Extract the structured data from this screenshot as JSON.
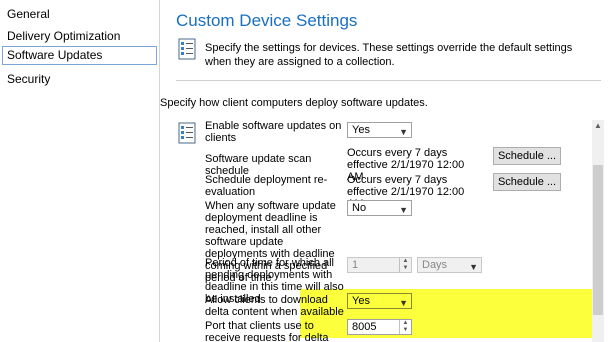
{
  "nav": {
    "items": [
      {
        "label": "General",
        "selected": false
      },
      {
        "label": "Delivery Optimization",
        "selected": false
      },
      {
        "label": "Software Updates",
        "selected": true
      },
      {
        "label": "Security",
        "selected": false
      }
    ]
  },
  "header": {
    "title": "Custom Device Settings",
    "description": "Specify the settings for devices. These settings override the default settings when they are assigned to a collection.",
    "icon": "settings-list-icon"
  },
  "main": {
    "lead": "Specify how client computers deploy software updates.",
    "rows": {
      "enable": {
        "label": "Enable software updates on clients",
        "value": "Yes",
        "icon": "settings-list-icon"
      },
      "scan": {
        "label": "Software update scan schedule",
        "value": "Occurs every 7 days effective 2/1/1970 12:00 AM",
        "button": "Schedule ..."
      },
      "reeval": {
        "label": "Schedule deployment re-evaluation",
        "value": "Occurs every 7 days effective 2/1/1970 12:00 AM",
        "button": "Schedule ..."
      },
      "deadline": {
        "label": "When any software update deployment deadline is reached, install all other software update deployments with deadline coming within a specified period of time",
        "value": "No"
      },
      "period": {
        "label": "Period of time for which all pending deployments with deadline in this time will also be installed",
        "value": "1",
        "unit": "Days"
      },
      "delta": {
        "label": "Allow clients to download delta content when available",
        "value": "Yes"
      },
      "port": {
        "label": "Port that clients use to receive requests for delta content",
        "value": "8005"
      }
    }
  },
  "colors": {
    "highlight": "#fcff3c",
    "title": "#1a6fc0"
  }
}
